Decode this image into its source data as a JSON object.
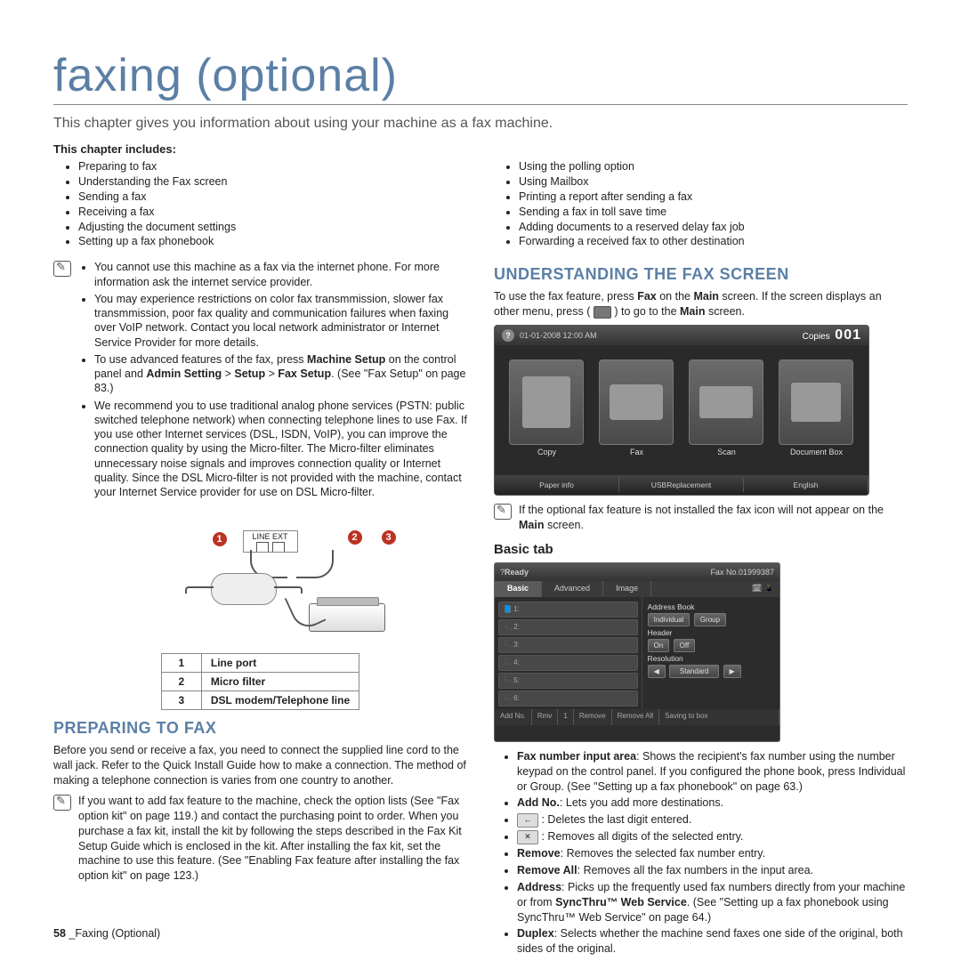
{
  "title": "faxing (optional)",
  "intro": "This chapter gives you information about using your machine as a fax machine.",
  "includes_label": "This chapter includes:",
  "topics_left": [
    "Preparing to fax",
    "Understanding the Fax screen",
    "Sending a fax",
    "Receiving a fax",
    "Adjusting the document settings",
    "Setting up a fax phonebook"
  ],
  "topics_right": [
    "Using the polling option",
    "Using Mailbox",
    "Printing a report after sending a fax",
    "Sending a fax in toll save time",
    "Adding documents to a reserved delay fax job",
    "Forwarding a received fax to other destination"
  ],
  "left_notes": [
    "You cannot use this machine as a fax via the internet phone. For more information ask the internet service provider.",
    "You may experience restrictions on color fax transmmission, slower fax transmmission, poor fax quality and communication failures when faxing over VoIP network. Contact you local network administrator or Internet Service Provider for more details.",
    "To use advanced features of the fax, press Machine Setup on the control panel and Admin Setting > Setup > Fax Setup. (See \"Fax Setup\" on page 83.)",
    "We recommend you to use traditional analog phone services (PSTN: public switched telephone network) when connecting telephone lines to use Fax. If you use other Internet services (DSL, ISDN, VoIP), you can improve the connection quality by using the Micro-filter. The Micro-filter eliminates unnecessary noise signals and improves connection quality or Internet quality. Since the DSL Micro-filter is not provided with the machine, contact your Internet Service provider for use on DSL Micro-filter."
  ],
  "diagram_labels": {
    "line_ext": "LINE  EXT"
  },
  "legend": [
    {
      "n": "1",
      "label": "Line port"
    },
    {
      "n": "2",
      "label": "Micro filter"
    },
    {
      "n": "3",
      "label": "DSL modem/Telephone line"
    }
  ],
  "section_prepare": {
    "heading": "PREPARING TO FAX",
    "body": "Before you send or receive a fax, you need to connect the supplied line cord to the wall jack. Refer to the Quick Install Guide how to make a connection. The method of making a telephone connection is varies from one country to another.",
    "note": "If you want to add fax feature to the machine, check the option lists (See \"Fax option kit\" on page 119.) and contact the purchasing point to order. When you purchase a fax kit, install the kit by following the steps described in the Fax Kit Setup Guide which is enclosed in the kit. After installing the fax kit, set the machine to use this feature. (See \"Enabling Fax feature after installing the fax option kit\" on page 123.)"
  },
  "section_understand": {
    "heading": "UNDERSTANDING THE FAX SCREEN",
    "body_pre": "To use the fax feature, press ",
    "body_fax": "Fax",
    "body_mid": " on the ",
    "body_main": "Main",
    "body_mid2": " screen. If the screen displays an other menu, press ( ",
    "body_go": " ) to go to the ",
    "body_main2": "Main",
    "body_end": " screen.",
    "screenshot": {
      "time": "01-01-2008 12:00 AM",
      "copies_label": "Copies",
      "copies_value": "001",
      "apps": [
        "Copy",
        "Fax",
        "Scan",
        "Document Box"
      ],
      "bottom": [
        "Paper info",
        "USBReplacement",
        "English"
      ]
    },
    "note": "If the optional fax feature is not installed the fax icon will not appear on the Main screen."
  },
  "section_basic": {
    "heading": "Basic tab",
    "tabshot": {
      "title_left": "Ready",
      "title_right": "Fax No.01999387",
      "tabs": [
        "Basic",
        "Advanced",
        "Image"
      ],
      "right": {
        "addrbook": "Address Book",
        "btn_individual": "Individual",
        "btn_group": "Group",
        "header_label": "Header",
        "btn_on": "On",
        "btn_off": "Off",
        "res_label": "Resolution",
        "btn_left": "◀",
        "res_value": "Standard",
        "btn_right": "▶"
      },
      "bottom": [
        "Add No.",
        "Rmv",
        "1",
        "Remove",
        "Remove All",
        "Saving to box"
      ]
    },
    "features": [
      {
        "label": "Fax number input area",
        "text": ": Shows the recipient's fax number using the number keypad on the control panel. If you configured the phone book, press Individual or Group. (See \"Setting up a fax phonebook\" on page 63.)"
      },
      {
        "label": "Add No.",
        "text": ": Lets you add more destinations."
      },
      {
        "icon": "←",
        "text": "Deletes the last digit entered."
      },
      {
        "icon": "✕",
        "text": "Removes all digits of the selected entry."
      },
      {
        "label": "Remove",
        "text": ": Removes the selected fax number entry."
      },
      {
        "label": "Remove All",
        "text": ": Removes all the fax numbers in the input area."
      },
      {
        "label": "Address",
        "text": ": Picks up the frequently used fax numbers directly from your machine or from SyncThru™ Web Service. (See \"Setting up a fax phonebook using SyncThru™ Web Service\" on page 64.)"
      },
      {
        "label": "Duplex",
        "text": ": Selects whether the machine send faxes one side of the original, both sides of the original."
      }
    ]
  },
  "footer_page": "58",
  "footer_text": "_Faxing (Optional)"
}
